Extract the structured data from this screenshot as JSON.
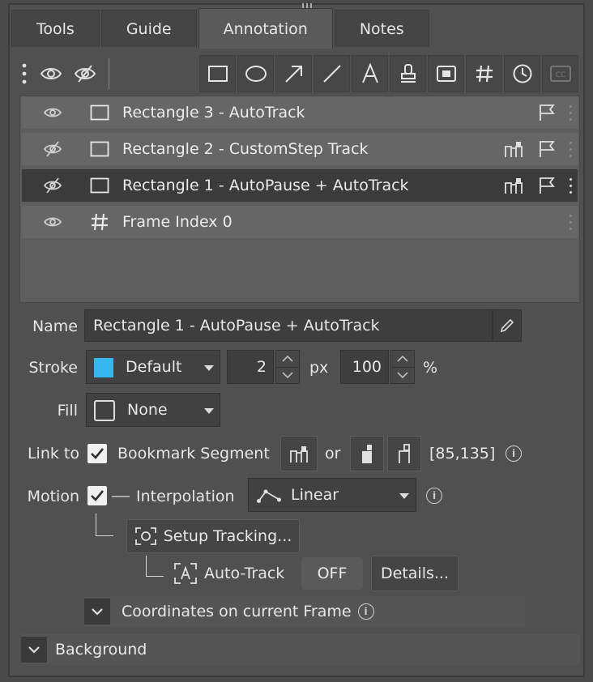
{
  "tabs": [
    {
      "label": "Tools"
    },
    {
      "label": "Guide"
    },
    {
      "label": "Annotation"
    },
    {
      "label": "Notes"
    }
  ],
  "toolbar": {
    "left_icons": [
      "more-vertical-icon",
      "eye-icon",
      "eye-off-icon"
    ],
    "shape_icons": [
      "rectangle-icon",
      "ellipse-icon",
      "arrow-icon",
      "line-icon",
      "text-icon",
      "stamp-icon",
      "mask-icon",
      "frame-index-icon",
      "clock-icon",
      "closed-caption-icon"
    ]
  },
  "layers": [
    {
      "label": "Rectangle 3 - AutoTrack",
      "visible": true,
      "kind": "rectangle",
      "segment": false,
      "flag": true,
      "selected": false
    },
    {
      "label": "Rectangle 2 - CustomStep Track",
      "visible": false,
      "kind": "rectangle",
      "segment": true,
      "flag": true,
      "selected": false
    },
    {
      "label": "Rectangle 1 - AutoPause + AutoTrack",
      "visible": false,
      "kind": "rectangle",
      "segment": true,
      "flag": true,
      "selected": true
    },
    {
      "label": "Frame Index 0",
      "visible": true,
      "kind": "frame-index",
      "segment": false,
      "flag": false,
      "selected": false
    }
  ],
  "props": {
    "name_label": "Name",
    "name_value": "Rectangle 1 - AutoPause + AutoTrack",
    "stroke_label": "Stroke",
    "stroke_color": "#35b8ef",
    "stroke_preset": "Default",
    "stroke_width": "2",
    "stroke_width_unit": "px",
    "stroke_opacity": "100",
    "stroke_opacity_unit": "%",
    "fill_label": "Fill",
    "fill_preset": "None",
    "link_label": "Link to",
    "link_checked": true,
    "link_target": "Bookmark Segment",
    "link_or": "or",
    "link_range": "[85,135]",
    "motion_label": "Motion",
    "motion_checked": true,
    "interpolation_label": "Interpolation",
    "interpolation_value": "Linear",
    "setup_tracking": "Setup Tracking...",
    "auto_track_label": "Auto-Track",
    "auto_track_state": "OFF",
    "details": "Details...",
    "coords_section": "Coordinates on current Frame",
    "background_section": "Background"
  }
}
